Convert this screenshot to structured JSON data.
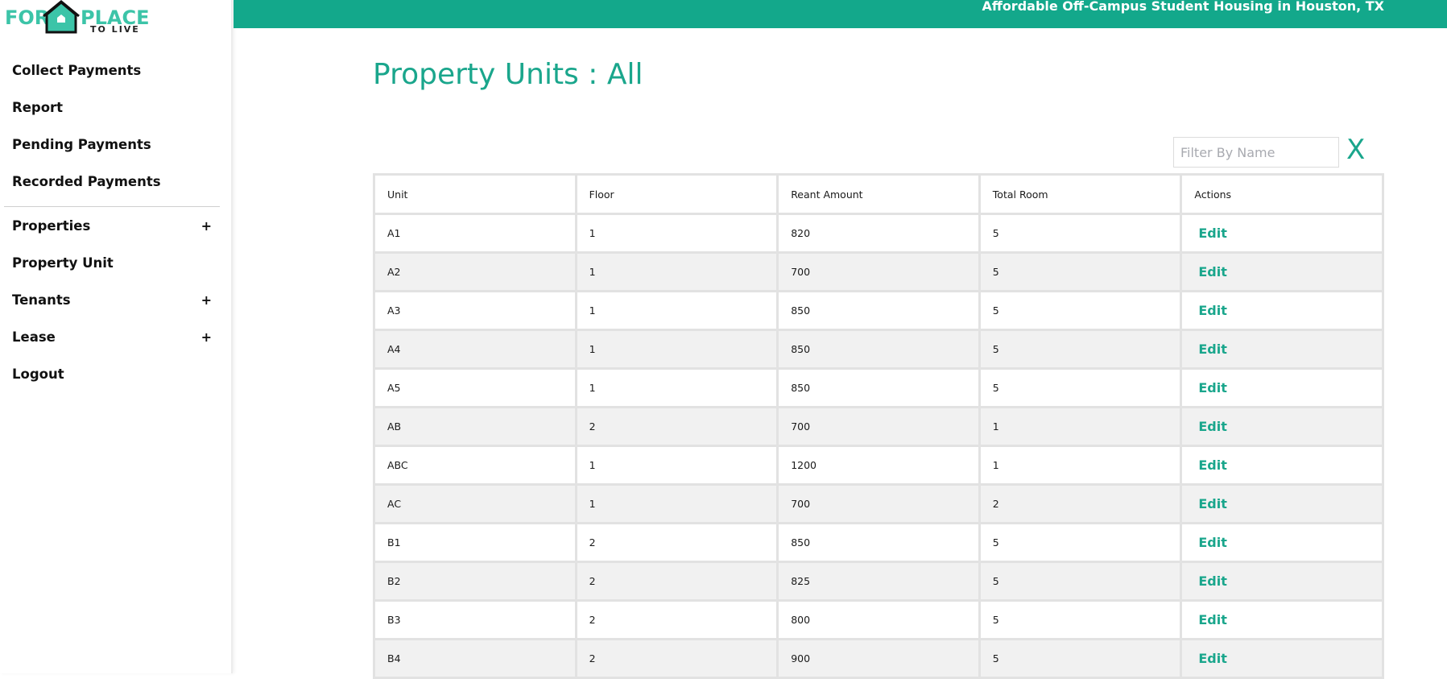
{
  "logo": {
    "left_word": "FOR",
    "right_word": "PLACE",
    "sub_word": "TO LIVE"
  },
  "header": {
    "tagline": "Affordable Off-Campus Student Housing in Houston, TX",
    "brand_color": "#13a88b"
  },
  "sidebar": {
    "items": [
      {
        "label": "Collect Payments",
        "expandable": false
      },
      {
        "label": "Report",
        "expandable": false
      },
      {
        "label": "Pending Payments",
        "expandable": false
      },
      {
        "label": "Recorded Payments",
        "expandable": false
      },
      {
        "label": "Properties",
        "expandable": true
      },
      {
        "label": "Property Unit",
        "expandable": false
      },
      {
        "label": "Tenants",
        "expandable": true
      },
      {
        "label": "Lease",
        "expandable": true
      },
      {
        "label": "Logout",
        "expandable": false
      }
    ],
    "expand_symbol": "+"
  },
  "main": {
    "title": "Property Units : All",
    "filter": {
      "placeholder": "Filter By Name",
      "value": "",
      "clear_label": "X"
    },
    "table": {
      "columns": [
        "Unit",
        "Floor",
        "Reant Amount",
        "Total Room",
        "Actions"
      ],
      "action_label": "Edit",
      "rows": [
        [
          "A1",
          "1",
          "820",
          "5"
        ],
        [
          "A2",
          "1",
          "700",
          "5"
        ],
        [
          "A3",
          "1",
          "850",
          "5"
        ],
        [
          "A4",
          "1",
          "850",
          "5"
        ],
        [
          "A5",
          "1",
          "850",
          "5"
        ],
        [
          "AB",
          "2",
          "700",
          "1"
        ],
        [
          "ABC",
          "1",
          "1200",
          "1"
        ],
        [
          "AC",
          "1",
          "700",
          "2"
        ],
        [
          "B1",
          "2",
          "850",
          "5"
        ],
        [
          "B2",
          "2",
          "825",
          "5"
        ],
        [
          "B3",
          "2",
          "800",
          "5"
        ],
        [
          "B4",
          "2",
          "900",
          "5"
        ]
      ]
    }
  }
}
